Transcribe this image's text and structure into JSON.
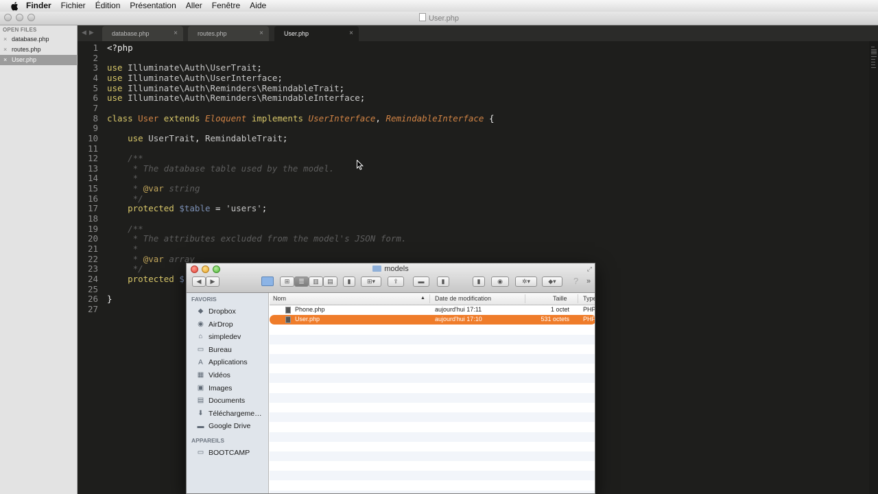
{
  "menubar": {
    "items": [
      "Finder",
      "Fichier",
      "Édition",
      "Présentation",
      "Aller",
      "Fenêtre",
      "Aide"
    ]
  },
  "editor_window": {
    "title": "User.php",
    "sidebar_header": "OPEN FILES",
    "open_files": [
      {
        "name": "database.php",
        "selected": false
      },
      {
        "name": "routes.php",
        "selected": false
      },
      {
        "name": "User.php",
        "selected": true
      }
    ],
    "tabs": [
      {
        "name": "database.php",
        "active": false
      },
      {
        "name": "routes.php",
        "active": false
      },
      {
        "name": "User.php",
        "active": true
      }
    ]
  },
  "code": {
    "line_numbers": [
      "1",
      "2",
      "3",
      "4",
      "5",
      "6",
      "7",
      "8",
      "9",
      "10",
      "11",
      "12",
      "13",
      "14",
      "15",
      "16",
      "17",
      "18",
      "19",
      "20",
      "21",
      "22",
      "23",
      "24",
      "25",
      "26",
      "27"
    ],
    "lines": [
      [
        {
          "t": "<?php",
          "c": "wh"
        }
      ],
      [],
      [
        {
          "t": "use ",
          "c": "kw"
        },
        {
          "t": "Illuminate\\Auth\\UserTrait",
          "c": "ns"
        },
        {
          "t": ";",
          "c": "wh"
        }
      ],
      [
        {
          "t": "use ",
          "c": "kw"
        },
        {
          "t": "Illuminate\\Auth\\UserInterface",
          "c": "ns"
        },
        {
          "t": ";",
          "c": "wh"
        }
      ],
      [
        {
          "t": "use ",
          "c": "kw"
        },
        {
          "t": "Illuminate\\Auth\\Reminders\\RemindableTrait",
          "c": "ns"
        },
        {
          "t": ";",
          "c": "wh"
        }
      ],
      [
        {
          "t": "use ",
          "c": "kw"
        },
        {
          "t": "Illuminate\\Auth\\Reminders\\RemindableInterface",
          "c": "ns"
        },
        {
          "t": ";",
          "c": "wh"
        }
      ],
      [],
      [
        {
          "t": "class ",
          "c": "kw"
        },
        {
          "t": "User ",
          "c": "cls"
        },
        {
          "t": "extends ",
          "c": "kw"
        },
        {
          "t": "Eloquent ",
          "c": "clsi"
        },
        {
          "t": "implements ",
          "c": "kw"
        },
        {
          "t": "UserInterface",
          "c": "clsi"
        },
        {
          "t": ", ",
          "c": "wh"
        },
        {
          "t": "RemindableInterface ",
          "c": "clsi"
        },
        {
          "t": "{",
          "c": "wh"
        }
      ],
      [],
      [
        {
          "t": "    use ",
          "c": "kw"
        },
        {
          "t": "UserTrait",
          "c": "ns"
        },
        {
          "t": ", ",
          "c": "wh"
        },
        {
          "t": "RemindableTrait",
          "c": "ns"
        },
        {
          "t": ";",
          "c": "wh"
        }
      ],
      [],
      [
        {
          "t": "    /**",
          "c": "cm"
        }
      ],
      [
        {
          "t": "     * The database table used by the model.",
          "c": "cm"
        }
      ],
      [
        {
          "t": "     *",
          "c": "cm"
        }
      ],
      [
        {
          "t": "     * ",
          "c": "cm"
        },
        {
          "t": "@var",
          "c": "cmt"
        },
        {
          "t": " string",
          "c": "cm"
        }
      ],
      [
        {
          "t": "     */",
          "c": "cm"
        }
      ],
      [
        {
          "t": "    protected ",
          "c": "kw"
        },
        {
          "t": "$table",
          "c": "var"
        },
        {
          "t": " = ",
          "c": "wh"
        },
        {
          "t": "'users'",
          "c": "str"
        },
        {
          "t": ";",
          "c": "wh"
        }
      ],
      [],
      [
        {
          "t": "    /**",
          "c": "cm"
        }
      ],
      [
        {
          "t": "     * The attributes excluded from the model's JSON form.",
          "c": "cm"
        }
      ],
      [
        {
          "t": "     *",
          "c": "cm"
        }
      ],
      [
        {
          "t": "     * ",
          "c": "cm"
        },
        {
          "t": "@var",
          "c": "cmt"
        },
        {
          "t": " array",
          "c": "cm"
        }
      ],
      [
        {
          "t": "     */",
          "c": "cm"
        }
      ],
      [
        {
          "t": "    protected ",
          "c": "kw"
        },
        {
          "t": "$",
          "c": "var"
        }
      ],
      [],
      [
        {
          "t": "}",
          "c": "wh"
        }
      ],
      []
    ]
  },
  "finder": {
    "title": "models",
    "sidebar": {
      "favorites_header": "FAVORIS",
      "favorites": [
        {
          "label": "Dropbox",
          "icon": "dropbox-icon"
        },
        {
          "label": "AirDrop",
          "icon": "airdrop-icon"
        },
        {
          "label": "simpledev",
          "icon": "home-icon"
        },
        {
          "label": "Bureau",
          "icon": "desktop-icon"
        },
        {
          "label": "Applications",
          "icon": "applications-icon"
        },
        {
          "label": "Vidéos",
          "icon": "movies-icon"
        },
        {
          "label": "Images",
          "icon": "pictures-icon"
        },
        {
          "label": "Documents",
          "icon": "documents-icon"
        },
        {
          "label": "Téléchargeme…",
          "icon": "downloads-icon"
        },
        {
          "label": "Google Drive",
          "icon": "folder-icon"
        }
      ],
      "devices_header": "APPAREILS",
      "devices": [
        {
          "label": "BOOTCAMP",
          "icon": "disk-icon"
        }
      ]
    },
    "columns": {
      "name": "Nom",
      "date": "Date de modification",
      "size": "Taille",
      "type": "Type"
    },
    "files": [
      {
        "name": "Phone.php",
        "date": "aujourd'hui 17:11",
        "size": "1 octet",
        "type": "PHP",
        "selected": false
      },
      {
        "name": "User.php",
        "date": "aujourd'hui 17:10",
        "size": "531 octets",
        "type": "PHP",
        "selected": true
      }
    ]
  }
}
